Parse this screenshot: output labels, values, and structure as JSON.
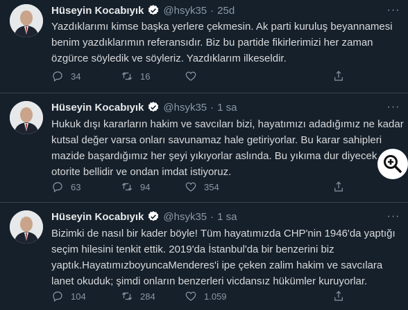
{
  "colors": {
    "background": "#15202b",
    "divider": "#38444d",
    "muted": "#8b98a5",
    "verified": "#ffffff"
  },
  "tweets": [
    {
      "name": "Hüseyin Kocabıyık",
      "handle": "@hsyk35",
      "separator": "·",
      "time": "25d",
      "lines": [
        "Yazdıklarımı kimse başka yerlere çekmesin. Ak parti kuruluş beyannamesi",
        "benim yazdıklarımın referansıdır. Biz bu partide fikirlerimizi her zaman",
        "özgürce söyledik ve söyleriz. Yazdıklarım ilkeseldir."
      ],
      "replies": "34",
      "retweets": "16",
      "likes": "",
      "icons": [
        "reply-icon",
        "retweet-icon",
        "like-icon",
        "share-icon"
      ]
    },
    {
      "name": "Hüseyin Kocabıyık",
      "handle": "@hsyk35",
      "separator": "·",
      "time": "1 sa",
      "lines": [
        "Hukuk dışı kararların hakim ve savcıları bizi, hayatımızı adadığımız ne kadar",
        "kutsal değer varsa onları savunamaz hale getiriyorlar. Bu karar sahipleri",
        "mazide başardığımız her şeyi yıkıyorlar aslında. Bu yıkıma dur diyecek",
        "otorite bellidir ve ondan imdat istiyoruz."
      ],
      "replies": "63",
      "retweets": "94",
      "likes": "354",
      "icons": [
        "reply-icon",
        "retweet-icon",
        "like-icon",
        "share-icon"
      ]
    },
    {
      "name": "Hüseyin Kocabıyık",
      "handle": "@hsyk35",
      "separator": "·",
      "time": "1 sa",
      "lines": [
        "Bizimki de nasıl bir kader böyle! Tüm hayatımızda CHP'nin 1946'da yaptığı",
        "seçim hilesini tenkit ettik. 2019'da İstanbul'da bir benzerini biz",
        "yaptık.HayatımızboyuncaMenderes'i ipe çeken zalim hakim ve savcılara",
        "lanet okuduk; şimdi onların benzerleri vicdansız hükümler kuruyorlar."
      ],
      "replies": "104",
      "retweets": "284",
      "likes": "1.059",
      "icons": [
        "reply-icon",
        "retweet-icon",
        "like-icon",
        "share-icon"
      ]
    }
  ],
  "zoom_icon": "zoom-in-icon"
}
